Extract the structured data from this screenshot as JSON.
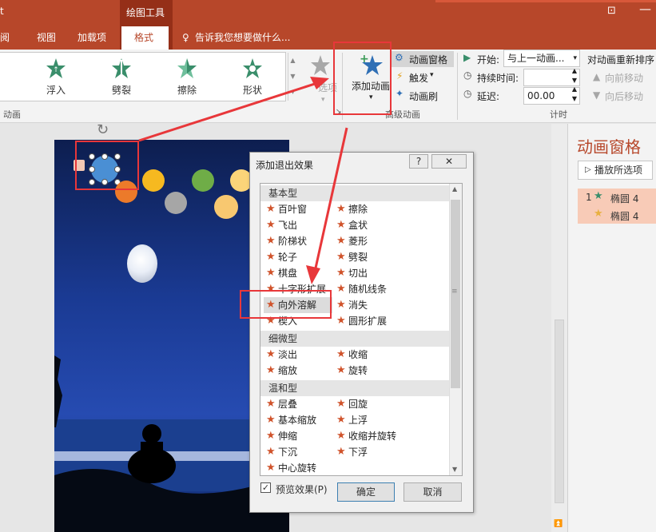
{
  "titlebar": {
    "app_fragment": "t",
    "tool_group": "绘图工具",
    "tabs": [
      "阅",
      "视图",
      "加载项",
      "格式"
    ],
    "tell_me": "告诉我您想要做什么..."
  },
  "ribbon": {
    "effects": [
      {
        "label": "浮入",
        "icon": "star-float-icon",
        "color": "#3a8e6b"
      },
      {
        "label": "劈裂",
        "icon": "star-split-icon",
        "color": "#3a8e6b"
      },
      {
        "label": "擦除",
        "icon": "star-wipe-icon",
        "color": "#4aa37f"
      },
      {
        "label": "形状",
        "icon": "star-shape-icon",
        "color": "#3a8e6b"
      }
    ],
    "effect_options_label": "选项",
    "group_animation": "动画",
    "add_animation": "添加动画",
    "animation_pane": "动画窗格",
    "trigger": "触发",
    "animation_painter": "动画刷",
    "group_advanced": "高级动画",
    "start_label": "开始:",
    "start_value": "与上一动画...",
    "duration_label": "持续时间:",
    "delay_label": "延迟:",
    "delay_value": "00.00",
    "reorder_title": "对动画重新排序",
    "move_earlier": "向前移动",
    "move_later": "向后移动",
    "group_timing": "计时"
  },
  "pane": {
    "title": "动画窗格",
    "play_button": "播放所选项",
    "items": [
      {
        "index": "1",
        "label": "椭圆 4"
      },
      {
        "index": "",
        "label": "椭圆 4"
      }
    ]
  },
  "dialog": {
    "title": "添加退出效果",
    "help": "?",
    "close": "✕",
    "categories": [
      "基本型",
      "细微型",
      "温和型"
    ],
    "basic": [
      "百叶窗",
      "擦除",
      "飞出",
      "盒状",
      "阶梯状",
      "菱形",
      "轮子",
      "劈裂",
      "棋盘",
      "切出",
      "十字形扩展",
      "随机线条",
      "向外溶解",
      "消失",
      "楔入",
      "圆形扩展"
    ],
    "subtle": [
      "淡出",
      "收缩",
      "缩放",
      "旋转"
    ],
    "moderate": [
      "层叠",
      "回旋",
      "基本缩放",
      "上浮",
      "伸缩",
      "收缩并旋转",
      "下沉",
      "下浮",
      "中心旋转"
    ],
    "selected": "向外溶解",
    "preview_label": "预览效果(P)",
    "ok": "确定",
    "cancel": "取消"
  },
  "colors": {
    "brand": "#b7472a",
    "annotation": "#e8373a",
    "star_exit": "#d0532b"
  }
}
